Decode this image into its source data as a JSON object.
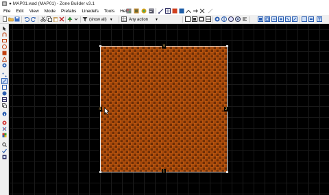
{
  "window": {
    "title": "● MAP01.wad (MAP01) - Zone Builder v3.1"
  },
  "menu": [
    "File",
    "Edit",
    "View",
    "Mode",
    "Prefabs",
    "Linedefs",
    "Tools",
    "Help"
  ],
  "toolbar": {
    "filter_label": "(show all)",
    "action_label": "Any action"
  },
  "map": {
    "linedef_labels": [
      "3",
      "2",
      "1",
      "4"
    ],
    "sector_texture": "checker-brick",
    "colors": {
      "grid_background": "#000000",
      "sector_dark": "#6e2e06",
      "sector_light": "#a8480a",
      "linedef": "#e8e8e8",
      "label": "#ffcc66"
    }
  },
  "icons": {
    "sidebar": [
      "cursor-icon",
      "hand-icon",
      "rectangle-draw-icon",
      "ellipse-draw-icon",
      "square-draw-icon",
      "triangle-draw-icon",
      "gear-icon",
      "vertices-mode-icon",
      "linedefs-mode-icon",
      "sectors-mode-icon",
      "things-mode-icon",
      "visual-mode-icon",
      "copy-icon",
      "info-icon",
      "eye-icon",
      "shape-icon",
      "color-icon",
      "zoom-icon",
      "checkmark-icon",
      "settings-icon"
    ]
  }
}
